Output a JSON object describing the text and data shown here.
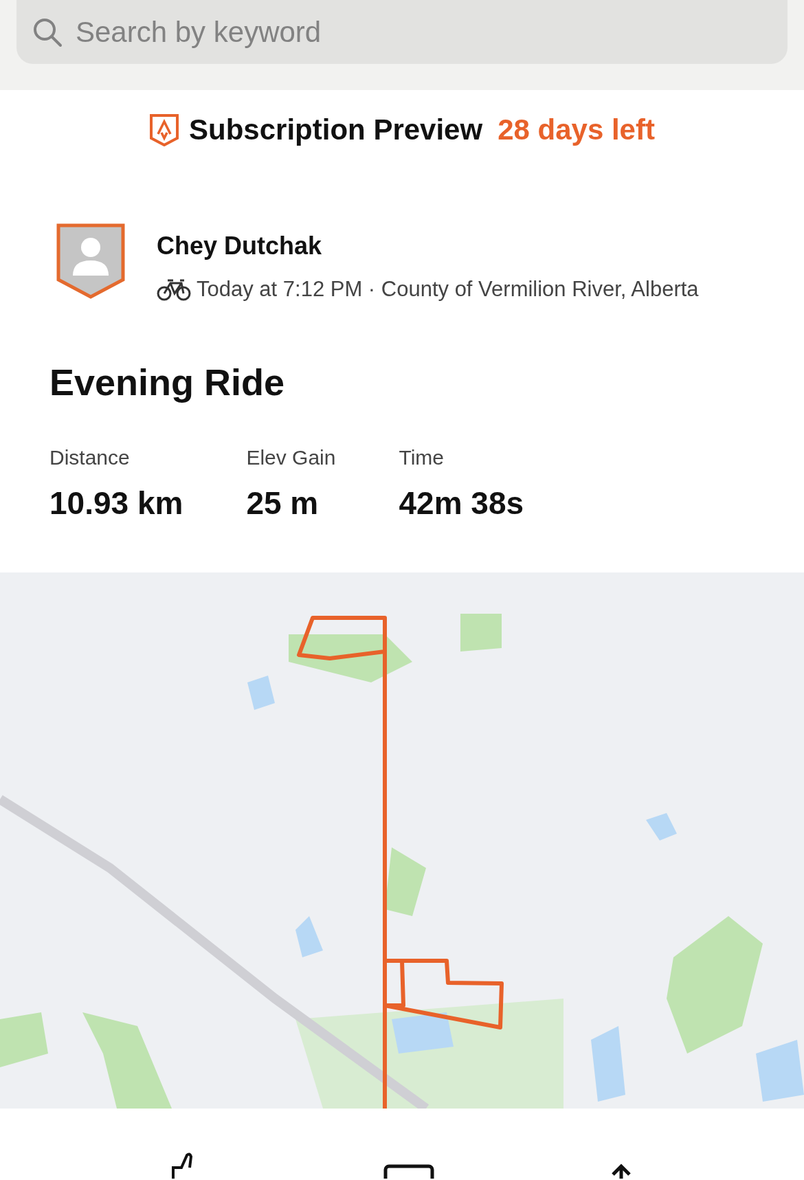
{
  "search": {
    "placeholder": "Search by keyword"
  },
  "subscription": {
    "title": "Subscription Preview",
    "remaining": "28 days left"
  },
  "activity": {
    "athlete": "Chey Dutchak",
    "meta": "Today at 7:12 PM · County of Vermilion River, Alberta",
    "title": "Evening Ride",
    "stats": [
      {
        "label": "Distance",
        "value": "10.93 km"
      },
      {
        "label": "Elev Gain",
        "value": "25 m"
      },
      {
        "label": "Time",
        "value": "42m 38s"
      }
    ]
  }
}
